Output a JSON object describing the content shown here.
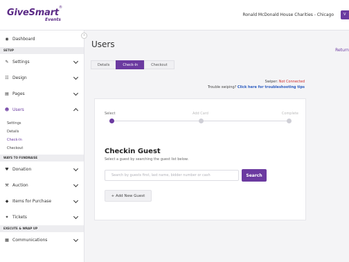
{
  "header": {
    "logo_main": "GiveSmart",
    "logo_tm": "®",
    "logo_sub": "Events",
    "org_name": "Ronald McDonald House Charities - Chicago",
    "org_button_label": "V"
  },
  "sidebar": {
    "collapse_icon": "‹",
    "top_items": [
      {
        "label": "Dashboard",
        "icon": "gauge-icon",
        "glyph": "◉"
      }
    ],
    "sections": {
      "setup": "SETUP",
      "ways_to_fundraise": "WAYS TO FUNDRAISE",
      "execute_wrap_up": "EXECUTE & WRAP UP"
    },
    "setup_items": [
      {
        "label": "Settings",
        "icon": "wrench-icon",
        "glyph": "✎"
      },
      {
        "label": "Design",
        "icon": "sliders-icon",
        "glyph": "☷"
      },
      {
        "label": "Pages",
        "icon": "page-icon",
        "glyph": "▤"
      },
      {
        "label": "Users",
        "icon": "users-icon",
        "glyph": "☻"
      }
    ],
    "users_sub_items": [
      {
        "label": "Settings"
      },
      {
        "label": "Details"
      },
      {
        "label": "Check-In"
      },
      {
        "label": "Checkout"
      }
    ],
    "fundraise_items": [
      {
        "label": "Donation",
        "icon": "heart-icon",
        "glyph": "♥"
      },
      {
        "label": "Auction",
        "icon": "gavel-icon",
        "glyph": "⚒"
      },
      {
        "label": "Items for Purchase",
        "icon": "tag-icon",
        "glyph": "◆"
      },
      {
        "label": "Tickets",
        "icon": "ticket-icon",
        "glyph": "✦"
      }
    ],
    "execute_items": [
      {
        "label": "Communications",
        "icon": "megaphone-icon",
        "glyph": "▦"
      }
    ]
  },
  "main": {
    "title": "Users",
    "return_link": "Return",
    "tabs": [
      {
        "label": "Details"
      },
      {
        "label": "Check-In"
      },
      {
        "label": "Checkout"
      }
    ],
    "swipe": {
      "status_prefix": "Swiper: ",
      "status_value": "Not Connected",
      "tips_prefix": "Trouble swiping? ",
      "tips_link": "Click here for troubleshooting tips"
    },
    "steps": [
      {
        "label": "Select"
      },
      {
        "label": "Add Card"
      },
      {
        "label": "Complete"
      }
    ],
    "card": {
      "title": "Checkin Guest",
      "subtitle": "Select a guest by searching the guest list below.",
      "search_placeholder": "Search by guests first, last name, bidder number or cash",
      "search_value": "",
      "search_button": "Search",
      "add_guest_button": "+ Add New Guest"
    }
  },
  "colors": {
    "brand": "#6b3aa0",
    "error": "#cc2a2a",
    "link": "#2a5bbf"
  }
}
